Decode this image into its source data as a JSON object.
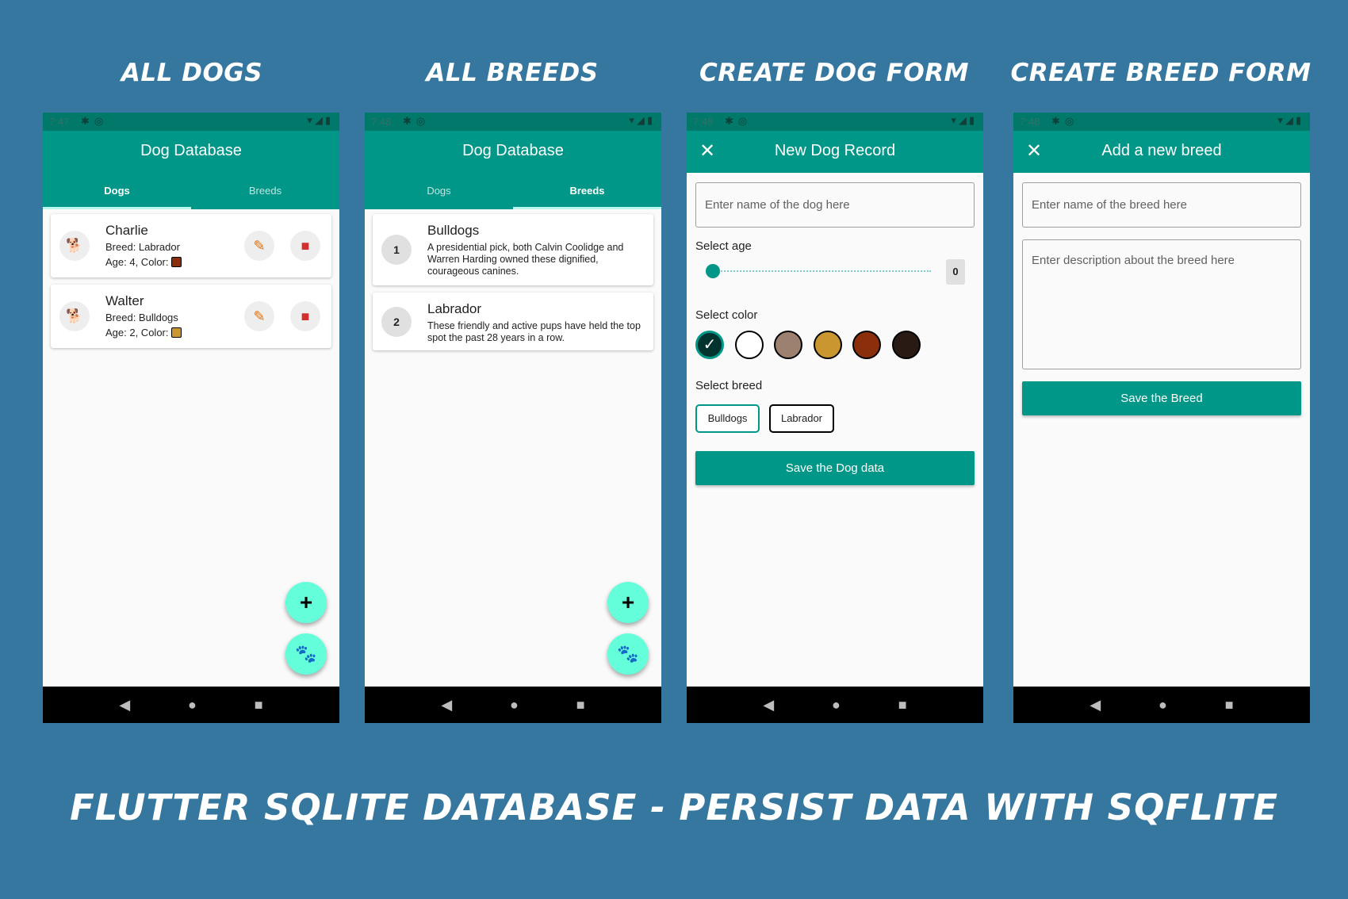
{
  "screen_titles": [
    "All Dogs",
    "All Breeds",
    "Create Dog Form",
    "Create Breed Form"
  ],
  "footer_title": "Flutter SQLite Database - Persist Data with SQFlite",
  "status_times": [
    "7:47",
    "7:48",
    "7:48",
    "7:48"
  ],
  "dogs_screen": {
    "app_title": "Dog Database",
    "tabs": [
      "Dogs",
      "Breeds"
    ],
    "active_tab": "Dogs",
    "dogs": [
      {
        "name": "Charlie",
        "breed": "Breed: Labrador",
        "age": "Age: 4, Color:",
        "color": "#8b2e0b"
      },
      {
        "name": "Walter",
        "breed": "Breed: Bulldogs",
        "age": "Age: 2, Color:",
        "color": "#c9962f"
      }
    ],
    "fab_icons": [
      "plus-icon",
      "paw-icon"
    ]
  },
  "breeds_screen": {
    "app_title": "Dog Database",
    "tabs": [
      "Dogs",
      "Breeds"
    ],
    "active_tab": "Breeds",
    "breeds": [
      {
        "num": "1",
        "name": "Bulldogs",
        "desc": "A presidential pick, both Calvin Coolidge and Warren Harding owned these dignified, courageous canines."
      },
      {
        "num": "2",
        "name": "Labrador",
        "desc": "These friendly and active pups have held the top spot the past 28 years in a row."
      }
    ]
  },
  "dog_form": {
    "app_title": "New Dog Record",
    "name_placeholder": "Enter name of the dog here",
    "age_label": "Select age",
    "age_value": "0",
    "color_label": "Select color",
    "colors": [
      "#00332e",
      "#ffffff",
      "#9c8070",
      "#c9962f",
      "#8b2e0b",
      "#2a1a14"
    ],
    "selected_color_index": 0,
    "breed_label": "Select breed",
    "breeds": [
      "Bulldogs",
      "Labrador"
    ],
    "selected_breed": "Bulldogs",
    "save_label": "Save the Dog data"
  },
  "breed_form": {
    "app_title": "Add a new breed",
    "name_placeholder": "Enter name of the breed here",
    "desc_placeholder": "Enter description about the breed here",
    "save_label": "Save the Breed"
  },
  "accent_colors": {
    "primary": "#009688",
    "status": "#00796b",
    "fab": "#64ffda",
    "background": "#3677a0",
    "edit": "#ef6c00",
    "delete": "#d32f2f"
  }
}
